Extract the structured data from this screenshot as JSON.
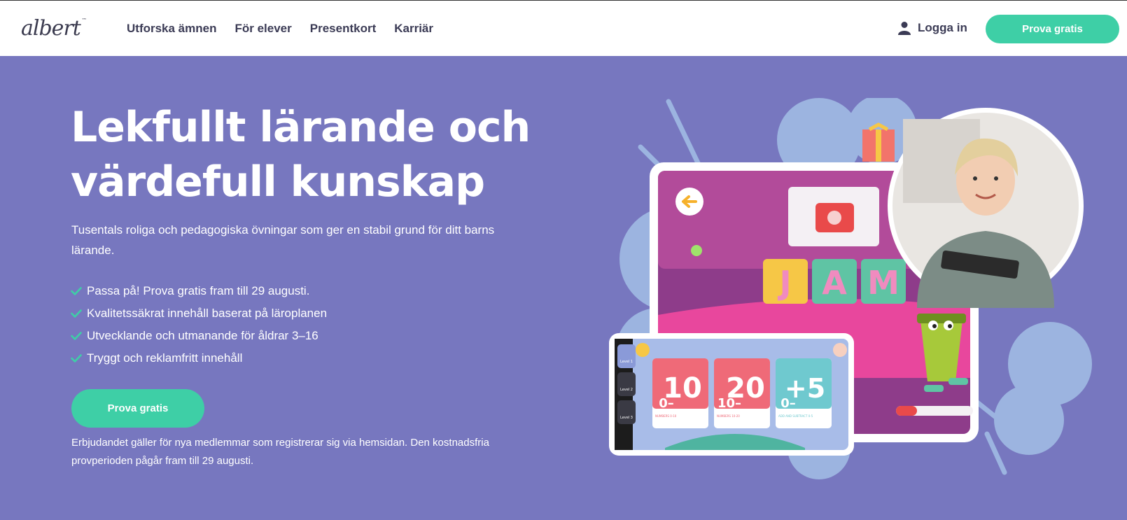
{
  "header": {
    "logo": "albert",
    "logo_tm": "™",
    "nav": [
      "Utforska ämnen",
      "För elever",
      "Presentkort",
      "Karriär"
    ],
    "login_label": "Logga in",
    "cta_label": "Prova gratis"
  },
  "hero": {
    "title_line1": "Lekfullt lärande och",
    "title_line2": "värdefull kunskap",
    "subtitle": "Tusentals roliga och pedagogiska övningar som ger en stabil grund för ditt barns lärande.",
    "features": [
      "Passa på! Prova gratis fram till 29 augusti.",
      "Kvalitetssäkrat innehåll baserat på läroplanen",
      "Utvecklande och utmanande för åldrar 3–16",
      "Tryggt och reklamfritt innehåll"
    ],
    "cta_label": "Prova gratis",
    "disclaimer": "Erbjudandet gäller för nya medlemmar som registrerar sig via hemsidan. Den kostnadsfria provperioden pågår fram till 29 augusti."
  },
  "illustration": {
    "game_word": [
      "J",
      "A",
      "M"
    ],
    "cards": [
      {
        "big": "10",
        "small": "0–",
        "caption": "NUMBERS 0-10"
      },
      {
        "big": "20",
        "small": "10–",
        "caption": "NUMBERS 10-20"
      },
      {
        "big": "+5",
        "small": "0–",
        "caption": "ADD AND SUBTRACT 0-5"
      }
    ],
    "levels": [
      "Level 1",
      "Level 2",
      "Level 3"
    ]
  },
  "colors": {
    "hero_bg": "#7777bf",
    "accent_green": "#3ecfa6",
    "nav_text": "#3b3b55"
  }
}
